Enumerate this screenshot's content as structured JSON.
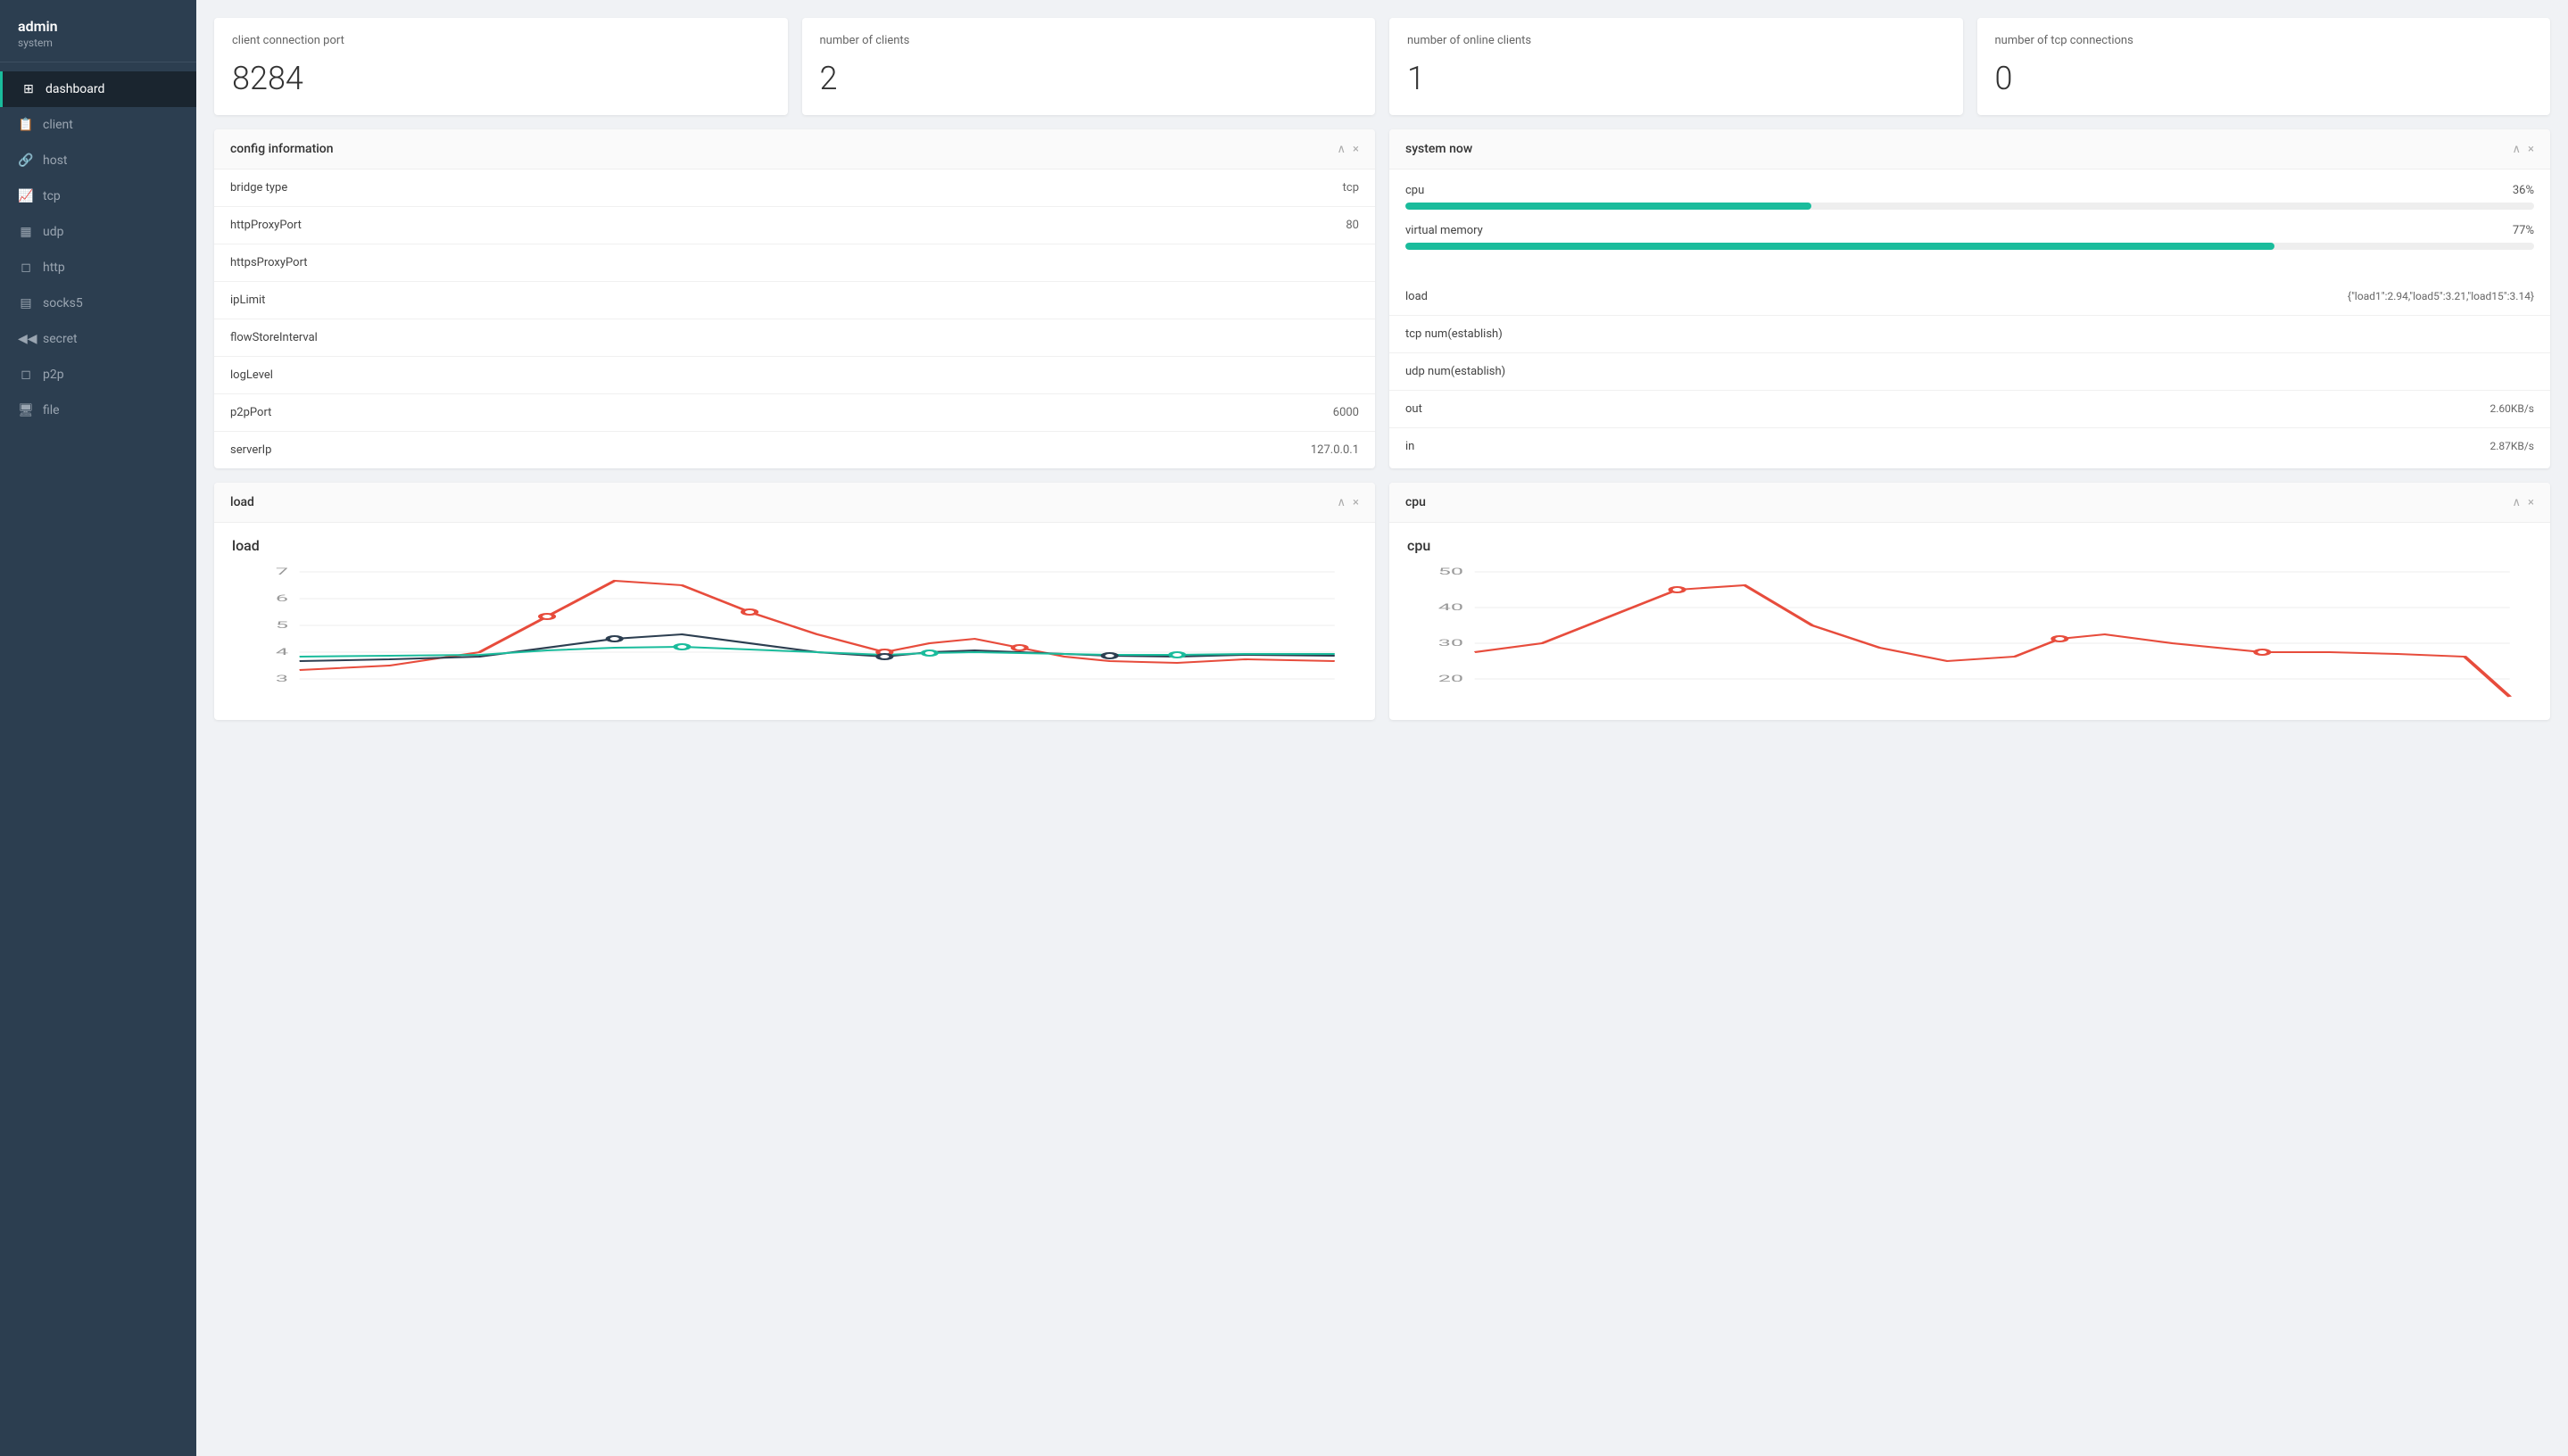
{
  "sidebar": {
    "username": "admin",
    "role": "system",
    "nav_items": [
      {
        "id": "dashboard",
        "label": "dashboard",
        "icon": "⊞",
        "active": true
      },
      {
        "id": "client",
        "label": "client",
        "icon": "📄"
      },
      {
        "id": "host",
        "label": "host",
        "icon": "🔗"
      },
      {
        "id": "tcp",
        "label": "tcp",
        "icon": "📈"
      },
      {
        "id": "udp",
        "label": "udp",
        "icon": "▦"
      },
      {
        "id": "http",
        "label": "http",
        "icon": "🌐"
      },
      {
        "id": "socks5",
        "label": "socks5",
        "icon": "▦"
      },
      {
        "id": "secret",
        "label": "secret",
        "icon": "◄◄"
      },
      {
        "id": "p2p",
        "label": "p2p",
        "icon": "◻"
      },
      {
        "id": "file",
        "label": "file",
        "icon": "🖥"
      }
    ]
  },
  "stats": [
    {
      "label": "client connection port",
      "value": "8284"
    },
    {
      "label": "number of clients",
      "value": "2"
    },
    {
      "label": "number of online clients",
      "value": "1"
    },
    {
      "label": "number of tcp connections",
      "value": "0"
    }
  ],
  "config_panel": {
    "title": "config information",
    "rows": [
      {
        "key": "bridge type",
        "value": "tcp"
      },
      {
        "key": "httpProxyPort",
        "value": "80"
      },
      {
        "key": "httpsProxyPort",
        "value": ""
      },
      {
        "key": "ipLimit",
        "value": ""
      },
      {
        "key": "flowStoreInterval",
        "value": ""
      },
      {
        "key": "logLevel",
        "value": ""
      },
      {
        "key": "p2pPort",
        "value": "6000"
      },
      {
        "key": "serverIp",
        "value": "127.0.0.1"
      }
    ]
  },
  "system_panel": {
    "title": "system now",
    "cpu": {
      "label": "cpu",
      "pct": 36,
      "pct_label": "36%"
    },
    "virtual_memory": {
      "label": "virtual memory",
      "pct": 77,
      "pct_label": "77%"
    },
    "metrics": [
      {
        "key": "load",
        "value": "{\"load1\":2.94,\"load5\":3.21,\"load15\":3.14}"
      },
      {
        "key": "tcp num(establish)",
        "value": ""
      },
      {
        "key": "udp num(establish)",
        "value": ""
      },
      {
        "key": "out",
        "value": "2.60KB/s"
      },
      {
        "key": "in",
        "value": "2.87KB/s"
      }
    ]
  },
  "load_panel": {
    "title": "load",
    "chart_title": "load",
    "y_labels": [
      "7",
      "6",
      "5",
      "4",
      "3"
    ]
  },
  "cpu_panel": {
    "title": "cpu",
    "chart_title": "cpu",
    "y_labels": [
      "50",
      "40",
      "30",
      "20"
    ]
  },
  "controls": {
    "collapse": "∧",
    "close": "×"
  }
}
